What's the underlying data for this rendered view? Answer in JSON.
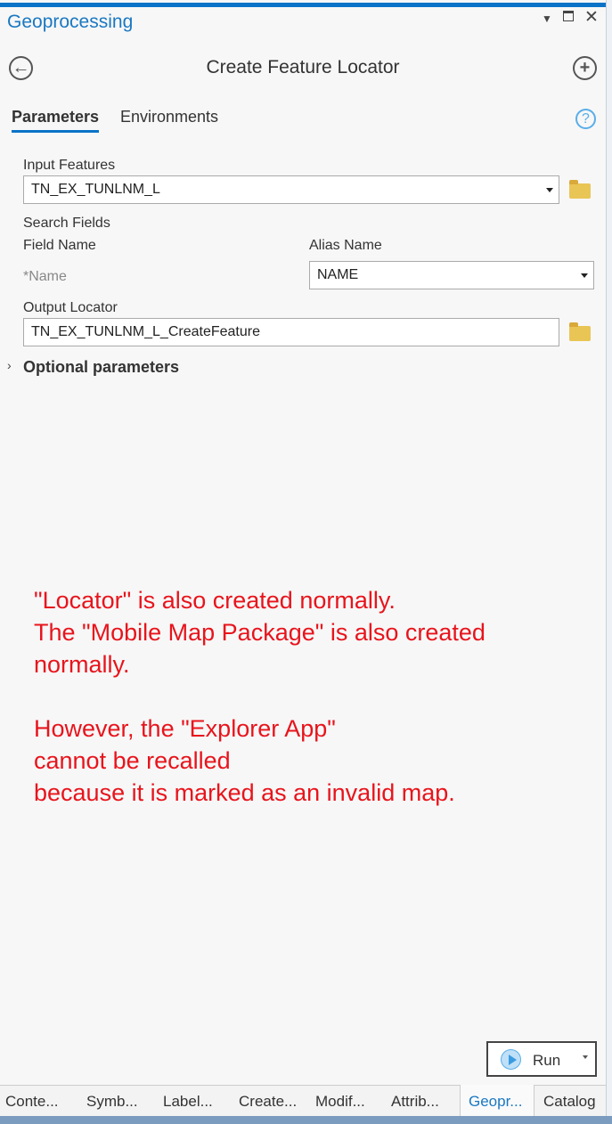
{
  "pane": {
    "title": "Geoprocessing",
    "tool_title": "Create Feature Locator"
  },
  "tabs": [
    {
      "label": "Parameters",
      "active": true
    },
    {
      "label": "Environments",
      "active": false
    }
  ],
  "params": {
    "input_features_label": "Input Features",
    "input_features_value": "TN_EX_TUNLNM_L",
    "search_fields_label": "Search Fields",
    "field_name_header": "Field Name",
    "alias_name_header": "Alias Name",
    "field_name": "*Name",
    "alias_value": "NAME",
    "output_locator_label": "Output Locator",
    "output_locator_value": "TN_EX_TUNLNM_L_CreateFeature",
    "optional_label": "Optional parameters"
  },
  "note": "\"Locator\" is also created normally.\nThe \"Mobile Map Package\" is also created\nnormally.\n\nHowever, the \"Explorer App\"\ncannot be recalled\nbecause it is marked as an invalid map.",
  "run_label": "Run",
  "bottom_tabs": [
    "Conte...",
    "Symb...",
    "Label...",
    "Create...",
    "Modif...",
    "Attrib...",
    "Geopr...",
    "Catalog"
  ],
  "colors": {
    "accent": "#0a73c8",
    "note": "#e8141c"
  }
}
